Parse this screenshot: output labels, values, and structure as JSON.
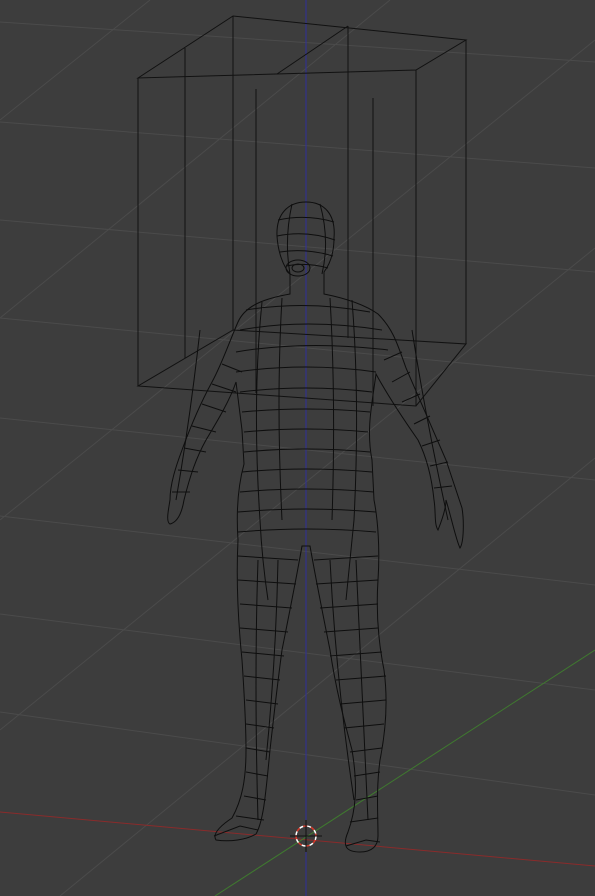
{
  "viewport": {
    "background": "#3d3d3d",
    "grid_color": "#4a4a4a",
    "x_axis_color": "#8a2b2b",
    "y_axis_color": "#3f7a2f",
    "z_axis_color": "#2f2f9a"
  },
  "objects": [
    {
      "name": "bounding-box",
      "kind": "wire-cuboid",
      "color": "#111111"
    },
    {
      "name": "human-mesh",
      "kind": "wireframe-mesh",
      "color": "#0e0e0e"
    },
    {
      "name": "3d-cursor",
      "kind": "cursor-icon",
      "colors": [
        "#ffffff",
        "#d83a2a"
      ]
    }
  ]
}
